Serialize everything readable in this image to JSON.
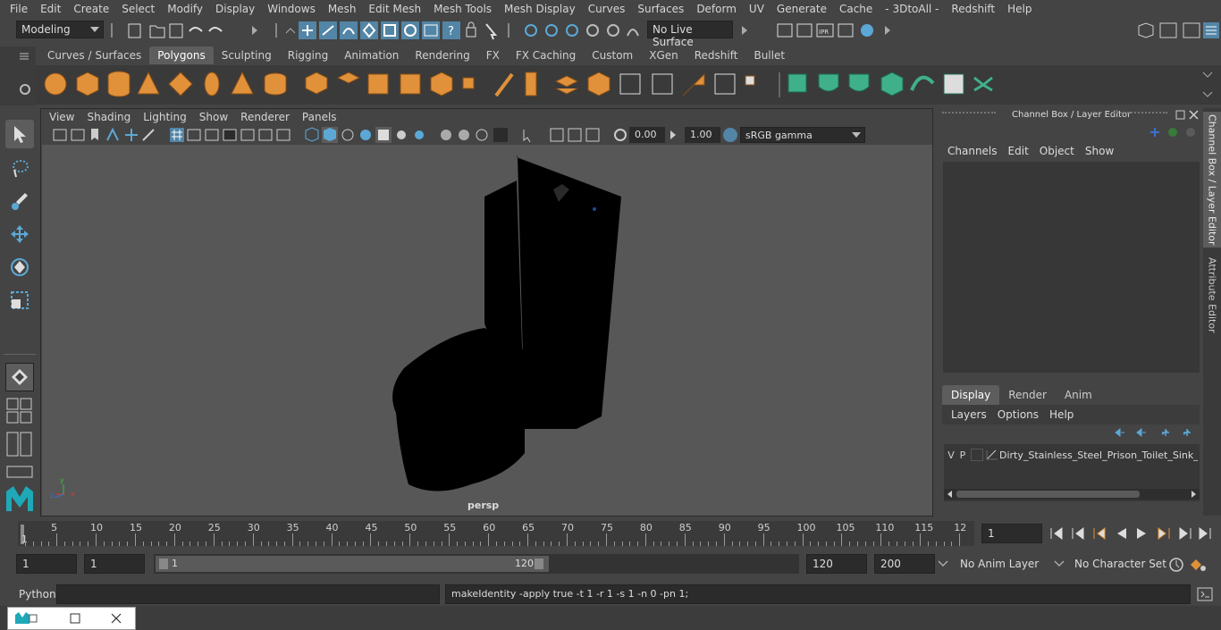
{
  "menubar": [
    "File",
    "Edit",
    "Create",
    "Select",
    "Modify",
    "Display",
    "Windows",
    "Mesh",
    "Edit Mesh",
    "Mesh Tools",
    "Mesh Display",
    "Curves",
    "Surfaces",
    "Deform",
    "UV",
    "Generate",
    "Cache",
    "- 3DtoAll -",
    "Redshift",
    "Help"
  ],
  "status": {
    "mode": "Modeling",
    "live_surface": "No Live Surface"
  },
  "shelf": {
    "tabs": [
      "Curves / Surfaces",
      "Polygons",
      "Sculpting",
      "Rigging",
      "Animation",
      "Rendering",
      "FX",
      "FX Caching",
      "Custom",
      "XGen",
      "Redshift",
      "Bullet"
    ],
    "active_tab": "Polygons"
  },
  "viewport": {
    "menu": [
      "View",
      "Shading",
      "Lighting",
      "Show",
      "Renderer",
      "Panels"
    ],
    "exposure": "0.00",
    "gamma": "1.00",
    "color_space": "sRGB gamma",
    "camera_label": "persp",
    "axis_labels": {
      "x": "x",
      "y": "y",
      "z": "z"
    }
  },
  "channel_box": {
    "title": "Channel Box / Layer Editor",
    "menu": [
      "Channels",
      "Edit",
      "Object",
      "Show"
    ]
  },
  "layer_editor": {
    "tabs": [
      "Display",
      "Render",
      "Anim"
    ],
    "active_tab": "Display",
    "menu": [
      "Layers",
      "Options",
      "Help"
    ],
    "layer": {
      "v": "V",
      "p": "P",
      "name": "Dirty_Stainless_Steel_Prison_Toilet_Sink_Combo"
    }
  },
  "side_tabs": [
    "Channel Box / Layer Editor",
    "Attribute Editor"
  ],
  "timeline": {
    "ticks": [
      "5",
      "10",
      "15",
      "20",
      "25",
      "30",
      "35",
      "40",
      "45",
      "50",
      "55",
      "60",
      "65",
      "70",
      "75",
      "80",
      "85",
      "90",
      "95",
      "100",
      "105",
      "110",
      "115",
      "12"
    ],
    "current_frame_marker": "1",
    "current_frame": "1"
  },
  "range": {
    "start": "1",
    "playback_start": "1",
    "slider_start": "1",
    "slider_end": "120",
    "playback_end": "120",
    "end": "200",
    "anim_layer": "No Anim Layer",
    "character_set": "No Character Set"
  },
  "command": {
    "language": "Python",
    "input": "",
    "result": "makeIdentity -apply true -t 1 -r 1 -s 1 -n 0 -pn 1;"
  },
  "colors": {
    "accent_blue": "#5285a6",
    "shelf_orange": "#e0913a",
    "shelf_green": "#3fb08a",
    "background": "#444444",
    "viewport": "#575757"
  }
}
